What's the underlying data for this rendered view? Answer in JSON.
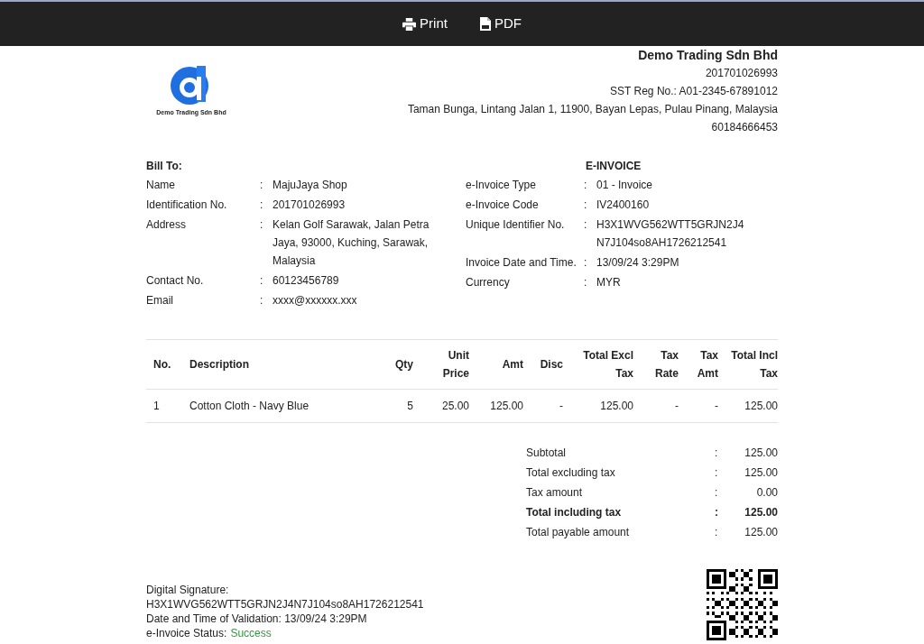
{
  "toolbar": {
    "buttons": [
      {
        "kind": "print",
        "label": "Print"
      },
      {
        "kind": "pdf",
        "label": "PDF"
      }
    ]
  },
  "logo": {
    "caption": "Demo Trading Sdn Bhd"
  },
  "company": {
    "name": "Demo Trading Sdn Bhd",
    "lines": [
      "201701026993",
      "SST Reg No.: A01-2345-67891012",
      "Taman Bunga, Lintang Jalan 1, 11900, Bayan Lepas, Pulau Pinang, Malaysia",
      "60184666453"
    ]
  },
  "bill_to": {
    "title": "Bill To:",
    "fields": [
      {
        "label": "Name",
        "separator": ":",
        "value": "MajuJaya Shop"
      },
      {
        "label": "Identification No.",
        "separator": ":",
        "value": "201701026993"
      },
      {
        "label": "Address",
        "separator": ":",
        "value": "Kelan Golf Sarawak, Jalan Petra Jaya, 93000, Kuching, Sarawak, Malaysia"
      },
      {
        "label": "Contact No.",
        "separator": ":",
        "value": "60123456789"
      },
      {
        "label": "Email",
        "separator": ":",
        "value": "xxxx@xxxxxx.xxx"
      }
    ]
  },
  "e_invoice": {
    "title": "E-INVOICE",
    "fields": [
      {
        "label": "e-Invoice Type",
        "separator": ":",
        "value": "01 - Invoice"
      },
      {
        "label": "e-Invoice Code",
        "separator": ":",
        "value": "IV2400160"
      },
      {
        "label": "Unique Identifier No.",
        "separator": ":",
        "value": "H3X1WVG562WTT5GRJN2J4N7J104so8AH1726212541"
      },
      {
        "label": "Invoice Date and Time.",
        "separator": ":",
        "value": "13/09/24 3:29PM"
      },
      {
        "label": "Currency",
        "separator": ":",
        "value": "MYR"
      }
    ]
  },
  "table": {
    "columns": [
      "No.",
      "Description",
      "Qty",
      "Unit Price",
      "Amt",
      "Disc",
      "Total Excl Tax",
      "Tax Rate",
      "Tax Amt",
      "Total Incl Tax"
    ],
    "rows": [
      [
        "1",
        "Cotton Cloth - Navy Blue",
        "5",
        "25.00",
        "125.00",
        "-",
        "125.00",
        "-",
        "-",
        "125.00"
      ]
    ]
  },
  "summary": [
    {
      "label": "Subtotal",
      "separator": ":",
      "value": "125.00",
      "bold": false
    },
    {
      "label": "Total excluding tax",
      "separator": ":",
      "value": "125.00",
      "bold": false
    },
    {
      "label": "Tax amount",
      "separator": ":",
      "value": "0.00",
      "bold": false
    },
    {
      "label": "Total including tax",
      "separator": ":",
      "value": "125.00",
      "bold": true
    },
    {
      "label": "Total payable amount",
      "separator": ":",
      "value": "125.00",
      "bold": false
    }
  ],
  "footer": {
    "signature_label": "Digital Signature:",
    "signature": "H3X1WVG562WTT5GRJN2J4N7J104so8AH1726212541",
    "validation": "Date and Time of Validation: 13/09/24 3:29PM",
    "status_label": "e-Invoice Status:",
    "status": {
      "text": "Success",
      "kind": "success"
    }
  }
}
